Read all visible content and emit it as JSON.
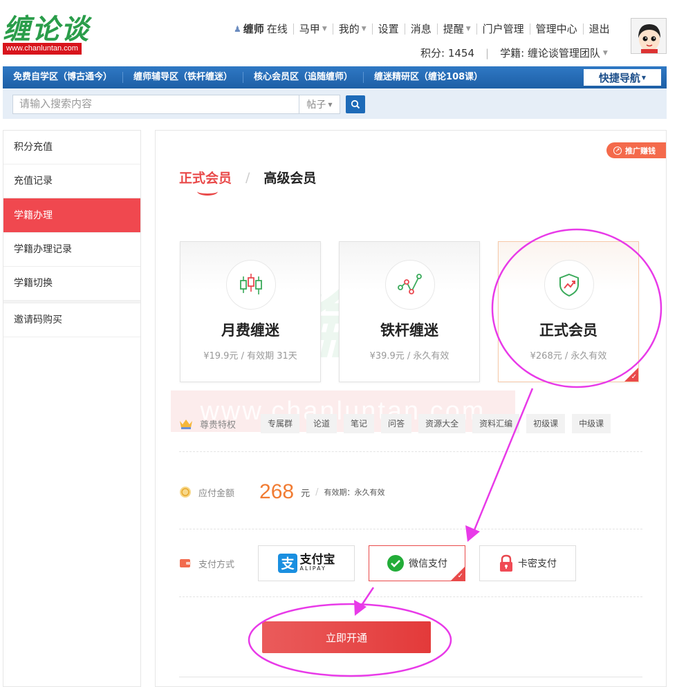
{
  "header": {
    "logo_text": "缠论谈",
    "logo_url": "www.chanluntan.com",
    "user_name": "缠师",
    "user_status": "在线",
    "nav": [
      {
        "label": "马甲",
        "dropdown": true
      },
      {
        "label": "我的",
        "dropdown": true
      },
      {
        "label": "设置",
        "dropdown": false
      },
      {
        "label": "消息",
        "dropdown": false
      },
      {
        "label": "提醒",
        "dropdown": true
      },
      {
        "label": "门户管理",
        "dropdown": false
      },
      {
        "label": "管理中心",
        "dropdown": false
      },
      {
        "label": "退出",
        "dropdown": false
      }
    ],
    "points": "积分: 1454",
    "school": "学籍: 缠论谈管理团队"
  },
  "menubar": {
    "items": [
      "免费自学区（博古通今）",
      "缠师辅导区（铁杆缠迷）",
      "核心会员区（追随缠师）",
      "缠迷精研区（缠论108课）"
    ],
    "quick_nav": "快捷导航"
  },
  "search": {
    "placeholder": "请输入搜索内容",
    "type": "帖子"
  },
  "sidebar": {
    "items": [
      "积分充值",
      "充值记录",
      "学籍办理",
      "学籍办理记录",
      "学籍切换",
      "邀请码购买"
    ],
    "active_index": 2
  },
  "main": {
    "promo": "推广赚钱",
    "tabs": [
      "正式会员",
      "高级会员"
    ],
    "watermark_url": "www.chanluntan.com",
    "plans": [
      {
        "name": "月费缠迷",
        "price": "¥19.9元 / 有效期 31天",
        "icon": "candlestick-icon"
      },
      {
        "name": "铁杆缠迷",
        "price": "¥39.9元 / 永久有效",
        "icon": "trend-line-icon"
      },
      {
        "name": "正式会员",
        "price": "¥268元 / 永久有效",
        "icon": "shield-chart-icon",
        "selected": true
      }
    ],
    "privileges_label": "尊贵特权",
    "privileges": [
      "专属群",
      "论道",
      "笔记",
      "问答",
      "资源大全",
      "资料汇编",
      "初级课",
      "中级课"
    ],
    "amount_label": "应付金额",
    "amount_value": "268",
    "amount_unit": "元",
    "validity": "有效期：永久有效",
    "pay_label": "支付方式",
    "pay_methods": {
      "alipay_main": "支付宝",
      "alipay_sub": "ALIPAY",
      "wechat": "微信支付",
      "card": "卡密支付"
    },
    "submit_label": "立即开通"
  },
  "colors": {
    "accent_red": "#e94a4a",
    "menu_blue": "#1d5fa6",
    "amount_orange": "#f17c33",
    "annotation_magenta": "#e83ae8"
  }
}
